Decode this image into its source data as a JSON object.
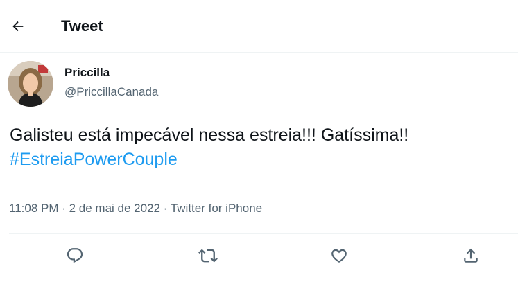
{
  "header": {
    "back_icon": "arrow-left-icon",
    "title": "Tweet"
  },
  "author": {
    "display_name": "Priccilla",
    "handle": "@PriccillaCanada"
  },
  "tweet": {
    "text": "Galisteu está impecável nessa estreia!!! Gatíssima!!",
    "hashtag": "#EstreiaPowerCouple"
  },
  "meta": {
    "time": "11:08 PM",
    "separator": " · ",
    "date": "2 de mai de 2022",
    "source": "Twitter for iPhone"
  },
  "actions": [
    {
      "icon": "reply-icon"
    },
    {
      "icon": "retweet-icon"
    },
    {
      "icon": "like-icon"
    },
    {
      "icon": "share-icon"
    }
  ],
  "colors": {
    "text": "#0f1419",
    "secondary": "#536471",
    "accent": "#1d9bf0",
    "divider": "#eff3f4"
  }
}
